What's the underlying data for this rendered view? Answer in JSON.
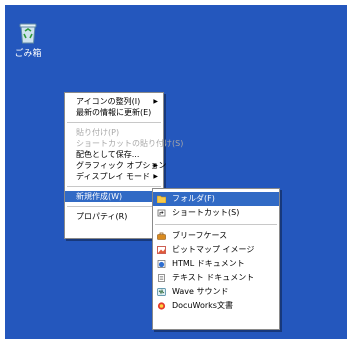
{
  "desktop": {
    "background": "#2457bd",
    "recycle_bin": {
      "label": "ごみ箱",
      "icon": "recycle-bin-icon"
    }
  },
  "context_menu": {
    "items": [
      {
        "label": "アイコンの整列(I)",
        "submenu": true,
        "enabled": true
      },
      {
        "label": "最新の情報に更新(E)",
        "submenu": false,
        "enabled": true
      },
      {
        "label": "貼り付け(P)",
        "submenu": false,
        "enabled": false
      },
      {
        "label": "ショートカットの貼り付け(S)",
        "submenu": false,
        "enabled": false
      },
      {
        "label": "配色として保存...",
        "submenu": false,
        "enabled": true
      },
      {
        "label": "グラフィック オプション",
        "submenu": true,
        "enabled": true
      },
      {
        "label": "ディスプレイ モード",
        "submenu": true,
        "enabled": true
      },
      {
        "label": "新規作成(W)",
        "submenu": true,
        "enabled": true,
        "highlighted": true
      },
      {
        "label": "プロパティ(R)",
        "submenu": false,
        "enabled": true
      }
    ]
  },
  "new_submenu": {
    "items": [
      {
        "label": "フォルダ(F)",
        "icon": "folder-icon",
        "highlighted": true
      },
      {
        "label": "ショートカット(S)",
        "icon": "shortcut-icon"
      },
      {
        "label": "ブリーフケース",
        "icon": "briefcase-icon"
      },
      {
        "label": "ビットマップ イメージ",
        "icon": "bitmap-icon"
      },
      {
        "label": "HTML ドキュメント",
        "icon": "html-document-icon"
      },
      {
        "label": "テキスト ドキュメント",
        "icon": "text-document-icon"
      },
      {
        "label": "Wave サウンド",
        "icon": "wave-sound-icon"
      },
      {
        "label": "DocuWorks文書",
        "icon": "docuworks-icon"
      }
    ]
  },
  "colors": {
    "highlight": "#316ac5",
    "disabled_text": "#a8a8a8"
  }
}
